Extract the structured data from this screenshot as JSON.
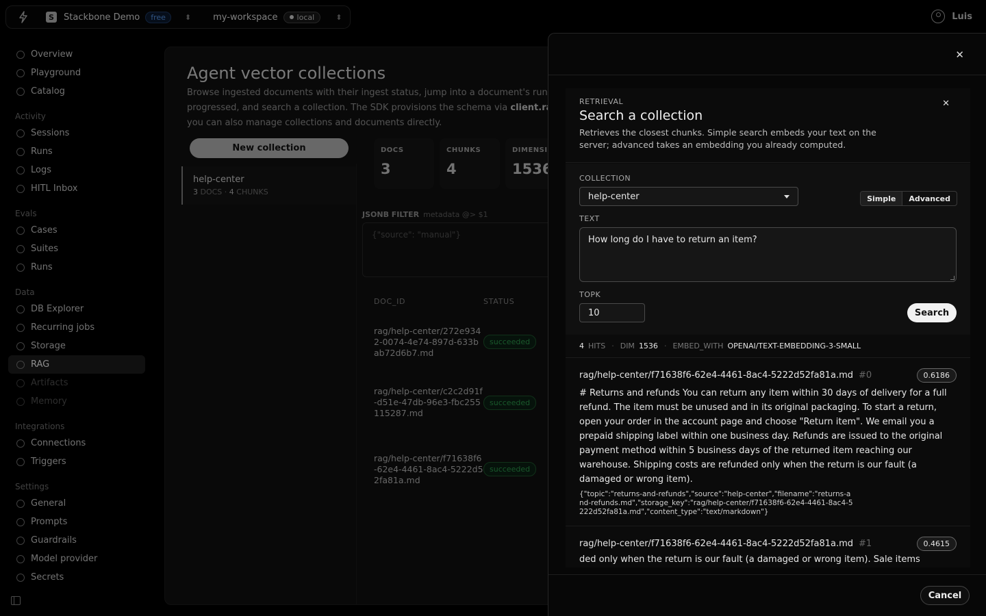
{
  "topbar": {
    "project_initial": "S",
    "project_name": "Stackbone Demo",
    "plan_badge": "free",
    "workspace": "my-workspace",
    "env_badge": "local",
    "user_name": "Luis"
  },
  "sidebar": {
    "top": [
      "Overview",
      "Playground",
      "Catalog"
    ],
    "groups": [
      {
        "label": "Activity",
        "items": [
          "Sessions",
          "Runs",
          "Logs",
          "HITL Inbox"
        ]
      },
      {
        "label": "Evals",
        "items": [
          "Cases",
          "Suites",
          "Runs"
        ]
      },
      {
        "label": "Data",
        "items": [
          "DB Explorer",
          "Recurring jobs",
          "Storage",
          "RAG",
          "Artifacts",
          "Memory"
        ]
      },
      {
        "label": "Integrations",
        "items": [
          "Connections",
          "Triggers"
        ]
      },
      {
        "label": "Settings",
        "items": [
          "General",
          "Prompts",
          "Guardrails",
          "Model provider",
          "Secrets"
        ]
      }
    ],
    "active_item": "RAG"
  },
  "main": {
    "title": "Agent vector collections",
    "desc_1": "Browse ingested documents with their ingest status, jump into a document's run to",
    "desc_2a": "progressed, and search a collection. The SDK provisions the schema via ",
    "desc_2b": "client.rag",
    "desc_3": "you can also manage collections and documents directly.",
    "new_collection": "New collection",
    "collection": {
      "name": "help-center",
      "docs": "3",
      "docs_label": "DOCS",
      "chunks": "4",
      "chunks_label": "CHUNKS"
    },
    "stats": [
      {
        "label": "DOCS",
        "value": "3"
      },
      {
        "label": "CHUNKS",
        "value": "4"
      },
      {
        "label": "DIMENSION",
        "value": "1536"
      }
    ],
    "jsonb_label": "JSONB FILTER",
    "jsonb_hint": "metadata @> $1",
    "jsonb_placeholder": "{\"source\": \"manual\"}",
    "table_headers": [
      "DOC_ID",
      "STATUS"
    ],
    "docs": [
      {
        "id": "rag/help-center/272e9342-0074-4e74-897d-633bab72d6b7.md",
        "status": "succeeded"
      },
      {
        "id": "rag/help-center/c2c2d91f-d51e-47db-96e3-fbc255115287.md",
        "status": "succeeded"
      },
      {
        "id": "rag/help-center/f71638f6-62e4-4461-8ac4-5222d52fa81a.md",
        "status": "succeeded"
      }
    ]
  },
  "drawer": {
    "eyebrow": "RETRIEVAL",
    "title": "Search a collection",
    "desc": "Retrieves the closest chunks. Simple search embeds your text on the server; advanced takes an embedding you already computed.",
    "collection_label": "COLLECTION",
    "collection_value": "help-center",
    "mode_simple": "Simple",
    "mode_advanced": "Advanced",
    "text_label": "TEXT",
    "text_value": "How long do I have to return an item?",
    "topk_label": "TOPK",
    "topk_value": "10",
    "search_button": "Search",
    "hits_count": "4",
    "hits_label": "HITS",
    "dim_label": "DIM",
    "dim_value": "1536",
    "embed_label": "EMBED_WITH",
    "embed_value": "OPENAI/TEXT-EMBEDDING-3-SMALL",
    "results": [
      {
        "title": "rag/help-center/f71638f6-62e4-4461-8ac4-5222d52fa81a.md",
        "index": "#0",
        "score": "0.6186",
        "text": "# Returns and refunds You can return any item within 30 days of delivery for a full refund. The item must be unused and in its original packaging. To start a return, open your order in the account page and choose \"Return item\". We email you a prepaid shipping label within one business day. Refunds are issued to the original payment method within 5 business days of the returned item reaching our warehouse. Shipping costs are refunded only when the return is our fault (a damaged or wrong item).",
        "meta": "{\"topic\":\"returns-and-refunds\",\"source\":\"help-center\",\"filename\":\"returns-and-refunds.md\",\"storage_key\":\"rag/help-center/f71638f6-62e4-4461-8ac4-5222d52fa81a.md\",\"content_type\":\"text/markdown\"}"
      },
      {
        "title": "rag/help-center/f71638f6-62e4-4461-8ac4-5222d52fa81a.md",
        "index": "#1",
        "score": "0.4615",
        "text": "ded only when the return is our fault (a damaged or wrong item). Sale items marked"
      }
    ],
    "cancel_button": "Cancel"
  }
}
